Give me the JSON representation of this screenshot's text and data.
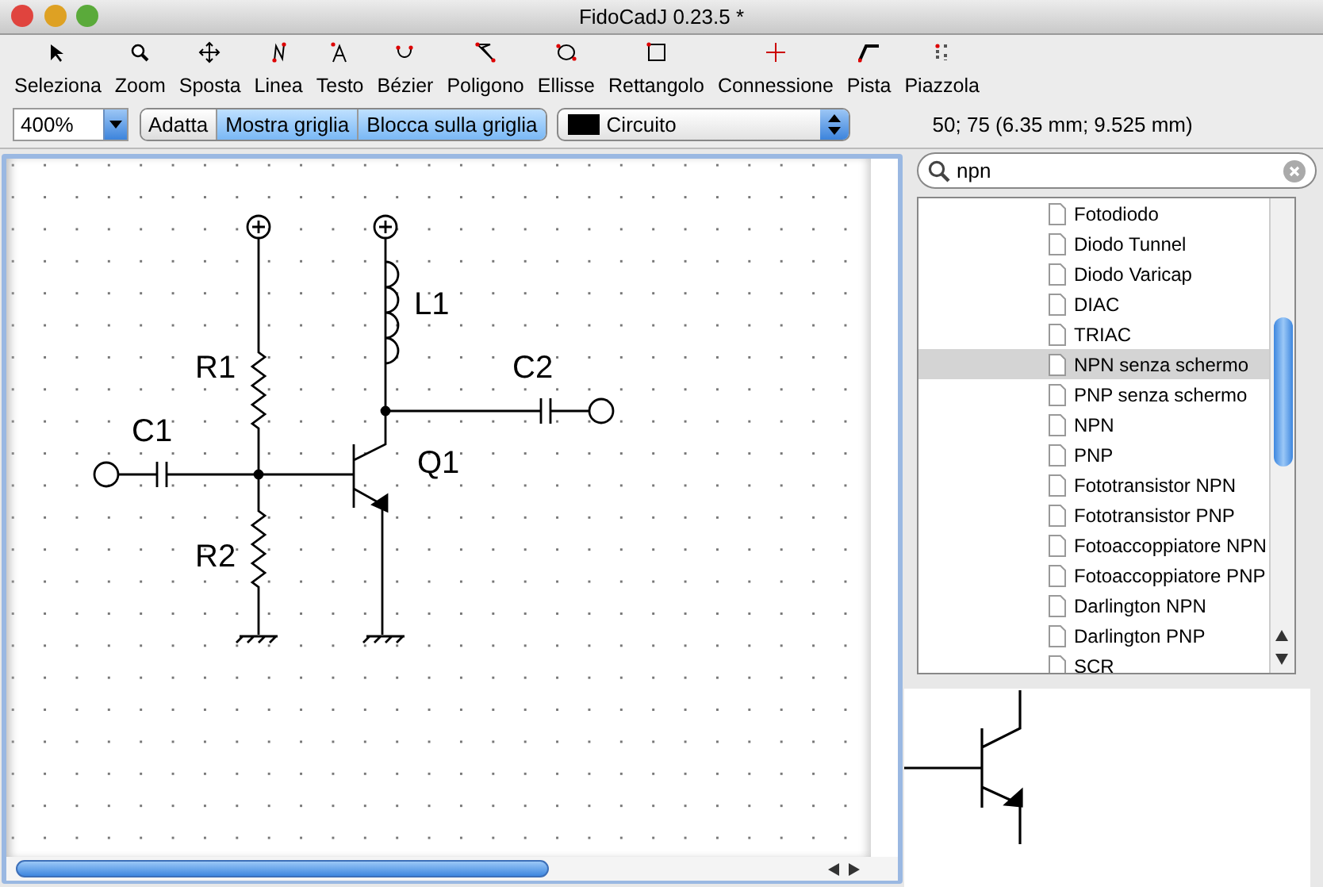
{
  "window": {
    "title": "FidoCadJ 0.23.5  *"
  },
  "tools": [
    {
      "label": "Seleziona",
      "selected": false
    },
    {
      "label": "Zoom",
      "selected": false
    },
    {
      "label": "Sposta",
      "selected": false
    },
    {
      "label": "Linea",
      "selected": false
    },
    {
      "label": "Testo",
      "selected": false
    },
    {
      "label": "Bézier",
      "selected": false
    },
    {
      "label": "Poligono",
      "selected": false
    },
    {
      "label": "Ellisse",
      "selected": false
    },
    {
      "label": "Rettangolo",
      "selected": false
    },
    {
      "label": "Connessione",
      "selected": false
    },
    {
      "label": "Pista",
      "selected": false
    },
    {
      "label": "Piazzola",
      "selected": false
    }
  ],
  "zoom_field": {
    "value": "400%"
  },
  "view_toggles": [
    {
      "label": "Adatta",
      "selected": false
    },
    {
      "label": "Mostra griglia",
      "selected": true
    },
    {
      "label": "Blocca sulla griglia",
      "selected": true
    }
  ],
  "layer_select": {
    "value": "Circuito",
    "color": "#000000"
  },
  "coordinates": "50; 75 (6.35 mm; 9.525 mm)",
  "schematic": {
    "labels": [
      "R1",
      "C1",
      "R2",
      "L1",
      "Q1",
      "C2"
    ]
  },
  "library": {
    "search": {
      "value": "npn"
    },
    "items": [
      {
        "label": "Fotodiodo",
        "selected": false
      },
      {
        "label": "Diodo Tunnel",
        "selected": false
      },
      {
        "label": "Diodo Varicap",
        "selected": false
      },
      {
        "label": "DIAC",
        "selected": false
      },
      {
        "label": "TRIAC",
        "selected": false
      },
      {
        "label": "NPN senza schermo",
        "selected": true
      },
      {
        "label": "PNP senza schermo",
        "selected": false
      },
      {
        "label": "NPN",
        "selected": false
      },
      {
        "label": "PNP",
        "selected": false
      },
      {
        "label": "Fototransistor NPN",
        "selected": false
      },
      {
        "label": "Fototransistor PNP",
        "selected": false
      },
      {
        "label": "Fotoaccoppiatore NPN",
        "selected": false
      },
      {
        "label": "Fotoaccoppiatore PNP",
        "selected": false
      },
      {
        "label": "Darlington NPN",
        "selected": false
      },
      {
        "label": "Darlington PNP",
        "selected": false
      },
      {
        "label": "SCR",
        "selected": false
      }
    ]
  }
}
